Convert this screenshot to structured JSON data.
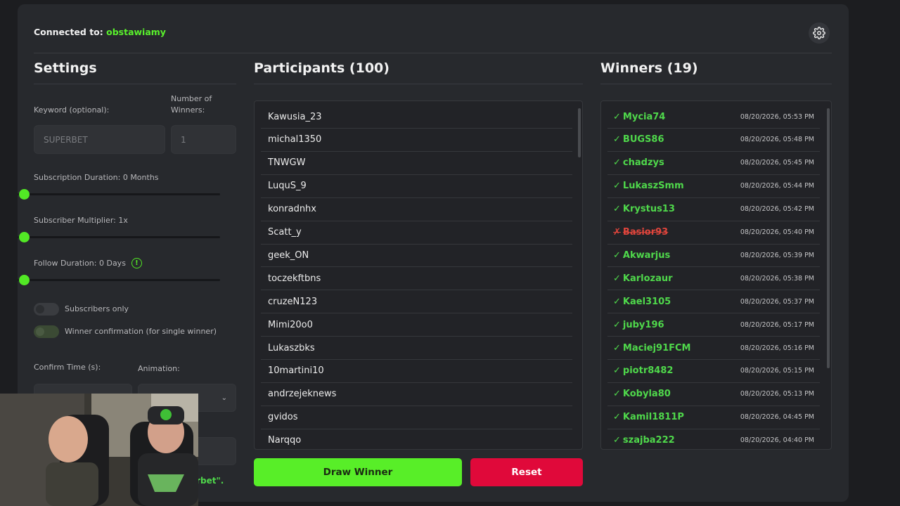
{
  "header": {
    "connected_label": "Connected to:",
    "channel": "obstawiamy"
  },
  "settings": {
    "title": "Settings",
    "keyword_label": "Keyword (optional):",
    "keyword_placeholder": "SUPERBET",
    "winners_count_label": "Number of Winners:",
    "winners_count_placeholder": "1",
    "sub_duration_label": "Subscription Duration: 0 Months",
    "sub_multiplier_label": "Subscriber Multiplier: 1x",
    "follow_duration_label": "Follow Duration:  0  Days",
    "subscribers_only_label": "Subscribers only",
    "winner_confirmation_label": "Winner confirmation (for single winner)",
    "confirm_time_label": "Confirm Time (s):",
    "animation_label": "Animation:",
    "partial_status_text": "erbet\"."
  },
  "participants": {
    "title": "Participants (100)",
    "items": [
      "Kawusia_23",
      "michal1350",
      "TNWGW",
      "LuquS_9",
      "konradnhx",
      "Scatt_y",
      "geek_ON",
      "toczekftbns",
      "cruzeN123",
      "Mimi20o0",
      "Lukaszbks",
      "10martini10",
      "andrzejeknews",
      "gvidos",
      "Narqqo"
    ]
  },
  "winners": {
    "title": "Winners (19)",
    "items": [
      {
        "mark": "✓",
        "name": "Mycia74",
        "time": "08/20/2026, 05:53 PM",
        "status": "ok"
      },
      {
        "mark": "✓",
        "name": "BUGS86",
        "time": "08/20/2026, 05:48 PM",
        "status": "ok"
      },
      {
        "mark": "✓",
        "name": "chadzys",
        "time": "08/20/2026, 05:45 PM",
        "status": "ok"
      },
      {
        "mark": "✓",
        "name": "LukaszSmm",
        "time": "08/20/2026, 05:44 PM",
        "status": "ok"
      },
      {
        "mark": "✓",
        "name": "Krystus13",
        "time": "08/20/2026, 05:42 PM",
        "status": "ok"
      },
      {
        "mark": "✗",
        "name": "Basior93",
        "time": "08/20/2026, 05:40 PM",
        "status": "rejected"
      },
      {
        "mark": "✓",
        "name": "Akwarjus",
        "time": "08/20/2026, 05:39 PM",
        "status": "ok"
      },
      {
        "mark": "✓",
        "name": "Karlozaur",
        "time": "08/20/2026, 05:38 PM",
        "status": "ok"
      },
      {
        "mark": "✓",
        "name": "Kael3105",
        "time": "08/20/2026, 05:37 PM",
        "status": "ok"
      },
      {
        "mark": "✓",
        "name": "juby196",
        "time": "08/20/2026, 05:17 PM",
        "status": "ok"
      },
      {
        "mark": "✓",
        "name": "Maciej91FCM",
        "time": "08/20/2026, 05:16 PM",
        "status": "ok"
      },
      {
        "mark": "✓",
        "name": "piotr8482",
        "time": "08/20/2026, 05:15 PM",
        "status": "ok"
      },
      {
        "mark": "✓",
        "name": "Kobyla80",
        "time": "08/20/2026, 05:13 PM",
        "status": "ok"
      },
      {
        "mark": "✓",
        "name": "Kamil1811P",
        "time": "08/20/2026, 04:45 PM",
        "status": "ok"
      },
      {
        "mark": "✓",
        "name": "szajba222",
        "time": "08/20/2026, 04:40 PM",
        "status": "ok"
      }
    ]
  },
  "actions": {
    "draw_label": "Draw Winner",
    "reset_label": "Reset"
  },
  "colors": {
    "accent": "#58ee28",
    "danger": "#e0093a",
    "winner": "#4fd84b"
  },
  "icons": {
    "settings": "gear-icon",
    "info": "info-icon",
    "dropdown": "chevron-down-icon"
  }
}
